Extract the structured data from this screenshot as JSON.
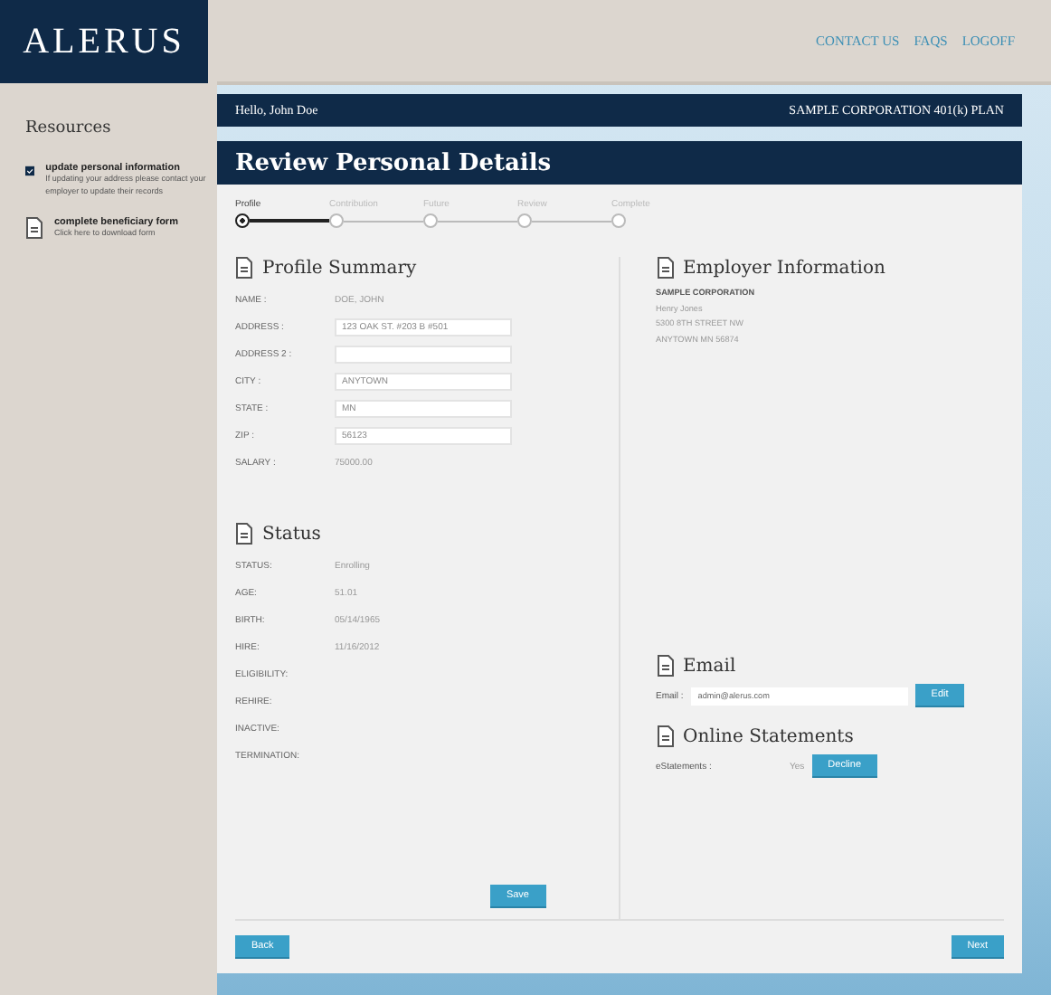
{
  "logo": "ALERUS",
  "top_links": [
    "CONTACT US",
    "FAQS",
    "LOGOFF"
  ],
  "sidebar": {
    "title": "Resources",
    "items": [
      {
        "kind": "checkbox",
        "checked": true,
        "title": "update personal information",
        "text": "If updating your address please contact your employer to update their records"
      },
      {
        "kind": "document",
        "title": "complete beneficiary form",
        "text": "Click here to download form"
      }
    ]
  },
  "greeting": "Hello, John Doe",
  "plan": "SAMPLE CORPORATION 401(k) PLAN",
  "page_title": "Review Personal Details",
  "steps": [
    {
      "label": "Profile",
      "selected": true
    },
    {
      "label": "Contribution",
      "selected": false
    },
    {
      "label": "Future",
      "selected": false
    },
    {
      "label": "Review",
      "selected": false
    },
    {
      "label": "Complete",
      "selected": false
    }
  ],
  "profile": {
    "title": "Profile Summary",
    "fields": [
      {
        "kind": "text",
        "label": "NAME :",
        "value": "DOE, JOHN"
      },
      {
        "kind": "input",
        "label": "ADDRESS :",
        "value": "123 OAK ST. #203 B #501"
      },
      {
        "kind": "input",
        "label": "ADDRESS 2 :"
      },
      {
        "kind": "input",
        "label": "CITY :",
        "value": "ANYTOWN"
      },
      {
        "kind": "input",
        "label": "STATE :",
        "value": "MN"
      },
      {
        "kind": "input",
        "label": "ZIP :",
        "value": "56123"
      },
      {
        "kind": "text",
        "label": "SALARY :",
        "value": "75000.00"
      }
    ]
  },
  "employer": {
    "title": "Employer Information",
    "lines": [
      "SAMPLE CORPORATION",
      "Henry Jones",
      "5300 8TH STREET NW",
      "ANYTOWN MN 56874"
    ]
  },
  "status": {
    "title": "Status",
    "fields": [
      {
        "label": "STATUS:",
        "value": "Enrolling"
      },
      {
        "label": "AGE:",
        "value": "51.01"
      },
      {
        "label": "BIRTH:",
        "value": "05/14/1965"
      },
      {
        "label": "HIRE:",
        "value": "11/16/2012"
      },
      {
        "label": "ELIGIBILITY:"
      },
      {
        "label": "REHIRE:"
      },
      {
        "label": "INACTIVE:"
      },
      {
        "label": "TERMINATION:"
      }
    ],
    "button": "Save"
  },
  "email": {
    "title": "Email",
    "label": "Email :",
    "value": "admin@alerus.com",
    "button": "Edit"
  },
  "statements": {
    "title": "Online Statements",
    "label": "eStatements :",
    "value": "Yes",
    "button": "Decline"
  },
  "nav": {
    "back": "Back",
    "next": "Next"
  }
}
